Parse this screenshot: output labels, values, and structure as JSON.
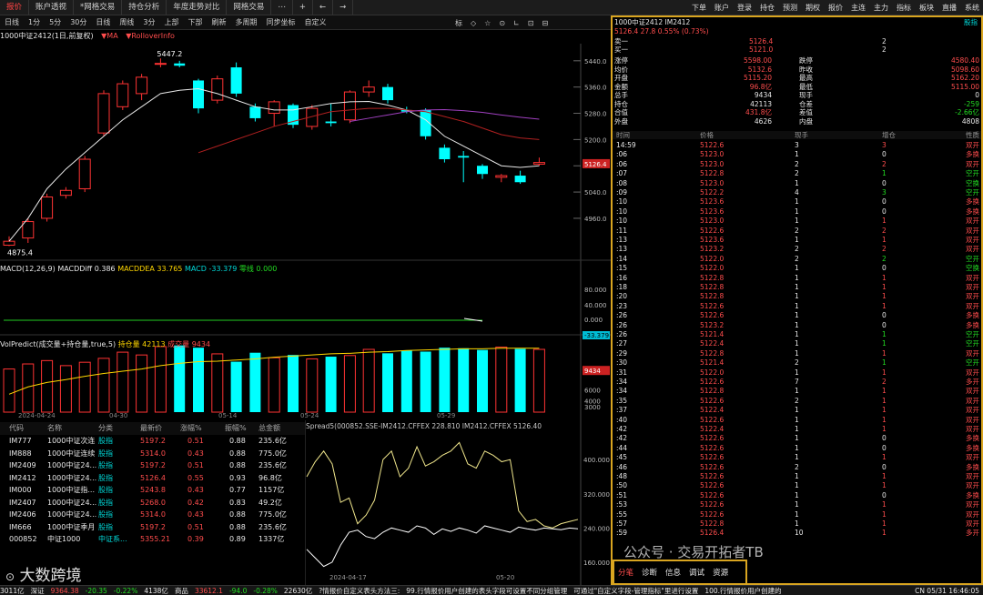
{
  "tabs": [
    {
      "label": "报价",
      "active": true
    },
    {
      "label": "账户透视"
    },
    {
      "label": "*网格交易"
    },
    {
      "label": "持仓分析"
    },
    {
      "label": "年度走势对比"
    },
    {
      "label": "网格交易"
    }
  ],
  "toolbar": {
    "close": "×",
    "add": "+",
    "prev": "←",
    "next": "→",
    "items": [
      "下单",
      "账户",
      "登录",
      "持仓",
      "预测",
      "期权",
      "报价",
      "主连",
      "主力",
      "指标",
      "板块",
      "直播",
      "系统"
    ]
  },
  "periods": [
    "日线",
    "1分",
    "5分",
    "30分",
    "日线",
    "周线",
    "3分",
    "上部",
    "下部",
    "刷新",
    "多周期",
    "同步坐标",
    "自定义"
  ],
  "period_right": [
    "标",
    "◇",
    "☆",
    "⊙",
    "∟",
    "⊡",
    "⊟"
  ],
  "chart_info": {
    "title": "1000中证2412(1日,前复权)",
    "ma": "▼MA",
    "rollover": "▼RolloverInfo"
  },
  "price_axis": [
    "5440.0",
    "5360.0",
    "5280.0",
    "5200.0",
    "5120.0",
    "5040.0",
    "4960.0"
  ],
  "current_price": "5126.4",
  "price_labels": {
    "high": "5447.2",
    "low": "4875.4"
  },
  "macd": {
    "label": "MACD(12,26,9)",
    "diff": "MACDDiff 0.386",
    "dea": "MACDDEA 33.765",
    "macd": "MACD -33.379",
    "zero": "零线 0.000",
    "axis": [
      "80.000",
      "40.000",
      "0.000"
    ],
    "value": "-33.379"
  },
  "vol": {
    "label": "VolPredict(成交量+持仓量,true,5)",
    "oi": "持仓量 42113",
    "volume": "成交量 9434",
    "axis": [
      "6000",
      "4000",
      "3000"
    ],
    "value": "9434"
  },
  "dates": [
    "2024-04-24",
    "04-30",
    "05-14",
    "05-24",
    "05-29"
  ],
  "chart_data": {
    "type": "candlestick",
    "candles": [
      {
        "o": 4878,
        "h": 4905,
        "l": 4875.4,
        "c": 4890
      },
      {
        "o": 4900,
        "h": 4960,
        "l": 4885,
        "c": 4950
      },
      {
        "o": 4960,
        "h": 5035,
        "l": 4950,
        "c": 5025
      },
      {
        "o": 5030,
        "h": 5055,
        "l": 5020,
        "c": 5045
      },
      {
        "o": 5050,
        "h": 5150,
        "l": 5040,
        "c": 5140
      },
      {
        "o": 5220,
        "h": 5350,
        "l": 5210,
        "c": 5340
      },
      {
        "o": 5300,
        "h": 5380,
        "l": 5290,
        "c": 5370
      },
      {
        "o": 5340,
        "h": 5400,
        "l": 5320,
        "c": 5390
      },
      {
        "o": 5430,
        "h": 5447.2,
        "l": 5420,
        "c": 5432
      },
      {
        "o": 5432,
        "h": 5440,
        "l": 5420,
        "c": 5425
      },
      {
        "o": 5380,
        "h": 5385,
        "l": 5280,
        "c": 5295
      },
      {
        "o": 5320,
        "h": 5395,
        "l": 5310,
        "c": 5385
      },
      {
        "o": 5420,
        "h": 5435,
        "l": 5330,
        "c": 5340
      },
      {
        "o": 5300,
        "h": 5310,
        "l": 5255,
        "c": 5265
      },
      {
        "o": 5280,
        "h": 5320,
        "l": 5240,
        "c": 5315
      },
      {
        "o": 5305,
        "h": 5310,
        "l": 5235,
        "c": 5245
      },
      {
        "o": 5240,
        "h": 5305,
        "l": 5230,
        "c": 5295
      },
      {
        "o": 5255,
        "h": 5310,
        "l": 5240,
        "c": 5250
      },
      {
        "o": 5260,
        "h": 5350,
        "l": 5250,
        "c": 5345
      },
      {
        "o": 5345,
        "h": 5380,
        "l": 5330,
        "c": 5360
      },
      {
        "o": 5360,
        "h": 5370,
        "l": 5310,
        "c": 5320
      },
      {
        "o": 5290,
        "h": 5300,
        "l": 5280,
        "c": 5285
      },
      {
        "o": 5290,
        "h": 5295,
        "l": 5200,
        "c": 5210
      },
      {
        "o": 5175,
        "h": 5185,
        "l": 5130,
        "c": 5140
      },
      {
        "o": 5150,
        "h": 5165,
        "l": 5070,
        "c": 5145
      },
      {
        "o": 5120,
        "h": 5125,
        "l": 5080,
        "c": 5095
      },
      {
        "o": 5085,
        "h": 5095,
        "l": 5070,
        "c": 5090
      },
      {
        "o": 5090,
        "h": 5105,
        "l": 5065,
        "c": 5070
      },
      {
        "o": 5125,
        "h": 5145,
        "l": 5120,
        "c": 5130
      }
    ],
    "ma_white": [
      4890,
      4960,
      5050,
      5110,
      5160,
      5210,
      5260,
      5300,
      5340,
      5350,
      5355,
      5340,
      5320,
      5300,
      5290,
      5290,
      5300,
      5310,
      5315,
      5316,
      5305,
      5290,
      5260,
      5210,
      5180,
      5150,
      5120,
      5115,
      5120
    ],
    "ma_red": [
      null,
      null,
      null,
      null,
      null,
      null,
      null,
      null,
      null,
      null,
      5160,
      5180,
      5200,
      5220,
      5240,
      5255,
      5270,
      5285,
      5290,
      5295,
      5295,
      5290,
      5285,
      5270,
      5255,
      5235,
      5215,
      5205,
      5200
    ],
    "ma_purple": [
      null,
      null,
      null,
      null,
      null,
      null,
      null,
      null,
      null,
      null,
      null,
      null,
      null,
      null,
      null,
      null,
      null,
      null,
      5255,
      5265,
      5275,
      5285,
      5290,
      5291,
      5288,
      5283,
      5275,
      5268,
      5262
    ],
    "volume": [
      9700,
      10600,
      11200,
      10300,
      10900,
      11600,
      12700,
      12200,
      13700,
      13900,
      13500,
      12400,
      11000,
      12600,
      11700,
      12200,
      11500,
      11900,
      12100,
      13200,
      12500,
      13000,
      12800,
      13500,
      13400,
      13100,
      13600,
      13300,
      13200
    ],
    "oi_line": [
      5200,
      6500,
      7300,
      7800,
      8400,
      8900,
      9300,
      9700,
      10300,
      10700,
      11000,
      11100,
      11300,
      11500,
      11800,
      12000,
      12200,
      12400,
      12500,
      12700,
      12800,
      13000,
      13100,
      13200,
      13300,
      13300,
      13400,
      13400,
      13400
    ],
    "spread_yellow": [
      360,
      395,
      420,
      390,
      300,
      310,
      250,
      270,
      305,
      400,
      420,
      360,
      380,
      430,
      385,
      395,
      410,
      420,
      440,
      390,
      380,
      420,
      410,
      395,
      400,
      280,
      255,
      260,
      245,
      240,
      250,
      255,
      260
    ],
    "spread_white": [
      190,
      170,
      150,
      160,
      200,
      230,
      235,
      220,
      215,
      230,
      240,
      235,
      230,
      245,
      240,
      225,
      238,
      232,
      240,
      235,
      228,
      245,
      240,
      235,
      230,
      242,
      238,
      235,
      240,
      238,
      236,
      240,
      238
    ]
  },
  "spread": {
    "label": "Spread5(000852.SSE-IM2412.CFFEX 228.810 IM2412.CFFEX 5126.40",
    "axis": [
      "400.000",
      "320.000",
      "240.000",
      "160.000"
    ],
    "dates": [
      "2024-04-17",
      "05-20"
    ]
  },
  "watchlist": {
    "headers": [
      "代码",
      "名称",
      "分类",
      "最新价",
      "涨幅%",
      "振幅%",
      "总金额"
    ],
    "rows": [
      [
        "IM777",
        "1000中证次连",
        "股指",
        "5197.2",
        "0.51",
        "0.88",
        "235.6亿"
      ],
      [
        "IM888",
        "1000中证连续",
        "股指",
        "5314.0",
        "0.43",
        "0.88",
        "775.0亿"
      ],
      [
        "IM2409",
        "1000中证24...",
        "股指",
        "5197.2",
        "0.51",
        "0.88",
        "235.6亿"
      ],
      [
        "IM2412",
        "1000中证24...",
        "股指",
        "5126.4",
        "0.55",
        "0.93",
        "96.8亿"
      ],
      [
        "IM000",
        "1000中证指...",
        "股指",
        "5243.8",
        "0.43",
        "0.77",
        "1157亿"
      ],
      [
        "IM2407",
        "1000中证24...",
        "股指",
        "5268.0",
        "0.42",
        "0.83",
        "49.2亿"
      ],
      [
        "IM2406",
        "1000中证24...",
        "股指",
        "5314.0",
        "0.43",
        "0.88",
        "775.0亿"
      ],
      [
        "IM666",
        "1000中证季月",
        "股指",
        "5197.2",
        "0.51",
        "0.88",
        "235.6亿"
      ],
      [
        "000852",
        "中证1000",
        "中证系...",
        "5355.21",
        "0.39",
        "0.89",
        "1337亿"
      ]
    ]
  },
  "quote": {
    "title": "1000中证2412 IM2412",
    "price_line": "5126.4  27.8  0.55%  (0.73%)",
    "button": "股指",
    "bid_ask": [
      [
        "卖一",
        "5126.4",
        "2"
      ],
      [
        "买一",
        "5121.0",
        "2"
      ]
    ],
    "stats": [
      [
        "涨停",
        "5598.00",
        "跌停",
        "4580.40"
      ],
      [
        "均价",
        "5132.6",
        "昨收",
        "5098.60"
      ],
      [
        "开盘",
        "5115.20",
        "最高",
        "5162.20"
      ],
      [
        "金额",
        "96.8亿",
        "最低",
        "5115.00"
      ],
      [
        "总手",
        "9434",
        "现手",
        "0"
      ],
      [
        "持仓",
        "42113",
        "仓差",
        "-259"
      ],
      [
        "合值",
        "431.8亿",
        "差值",
        "-2.66亿"
      ],
      [
        "外盘",
        "4626",
        "内盘",
        "4808"
      ]
    ]
  },
  "tick_headers": [
    "时间",
    "价格",
    "现手",
    "增仓",
    "性质"
  ],
  "ticks": [
    [
      "14:59",
      "5122.6",
      "3",
      "3",
      "双开",
      "red"
    ],
    [
      ":06",
      "5123.0",
      "1",
      "0",
      "多换",
      "red"
    ],
    [
      ":06",
      "5123.0",
      "2",
      "2",
      "双开",
      "red"
    ],
    [
      ":07",
      "5122.8",
      "2",
      "1",
      "空开",
      "green"
    ],
    [
      ":08",
      "5123.0",
      "1",
      "0",
      "空换",
      "green"
    ],
    [
      ":09",
      "5122.2",
      "4",
      "3",
      "空开",
      "green"
    ],
    [
      ":10",
      "5123.6",
      "1",
      "0",
      "多换",
      "red"
    ],
    [
      ":10",
      "5123.6",
      "1",
      "0",
      "多换",
      "red"
    ],
    [
      ":10",
      "5123.0",
      "1",
      "1",
      "双开",
      "red"
    ],
    [
      ":11",
      "5122.6",
      "2",
      "2",
      "双开",
      "red"
    ],
    [
      ":13",
      "5123.6",
      "1",
      "1",
      "双开",
      "red"
    ],
    [
      ":13",
      "5123.2",
      "2",
      "2",
      "双开",
      "red"
    ],
    [
      ":14",
      "5122.0",
      "2",
      "2",
      "空开",
      "green"
    ],
    [
      ":15",
      "5122.0",
      "1",
      "0",
      "空换",
      "green"
    ],
    [
      ":16",
      "5122.8",
      "1",
      "1",
      "双开",
      "red"
    ],
    [
      ":18",
      "5122.8",
      "1",
      "1",
      "双开",
      "red"
    ],
    [
      ":20",
      "5122.8",
      "1",
      "1",
      "双开",
      "red"
    ],
    [
      ":23",
      "5122.6",
      "1",
      "1",
      "双开",
      "red"
    ],
    [
      ":26",
      "5122.6",
      "1",
      "0",
      "多换",
      "red"
    ],
    [
      ":26",
      "5123.2",
      "1",
      "0",
      "多换",
      "red"
    ],
    [
      ":26",
      "5121.4",
      "1",
      "1",
      "空开",
      "green"
    ],
    [
      ":27",
      "5122.4",
      "1",
      "1",
      "空开",
      "green"
    ],
    [
      ":29",
      "5122.8",
      "1",
      "1",
      "双开",
      "red"
    ],
    [
      ":30",
      "5121.4",
      "2",
      "1",
      "空开",
      "green"
    ],
    [
      ":31",
      "5122.0",
      "1",
      "1",
      "双开",
      "red"
    ],
    [
      ":34",
      "5122.6",
      "7",
      "2",
      "多开",
      "red"
    ],
    [
      ":34",
      "5122.8",
      "1",
      "1",
      "双开",
      "red"
    ],
    [
      ":35",
      "5122.6",
      "2",
      "1",
      "双开",
      "red"
    ],
    [
      ":37",
      "5122.4",
      "1",
      "1",
      "双开",
      "red"
    ],
    [
      ":40",
      "5122.6",
      "1",
      "1",
      "双开",
      "red"
    ],
    [
      ":42",
      "5122.4",
      "1",
      "1",
      "双开",
      "red"
    ],
    [
      ":42",
      "5122.6",
      "1",
      "0",
      "多换",
      "red"
    ],
    [
      ":44",
      "5122.6",
      "1",
      "0",
      "多换",
      "red"
    ],
    [
      ":45",
      "5122.6",
      "1",
      "1",
      "双开",
      "red"
    ],
    [
      ":46",
      "5122.6",
      "2",
      "0",
      "多换",
      "red"
    ],
    [
      ":48",
      "5122.6",
      "1",
      "1",
      "双开",
      "red"
    ],
    [
      ":50",
      "5122.6",
      "1",
      "1",
      "双开",
      "red"
    ],
    [
      ":51",
      "5122.6",
      "1",
      "0",
      "多换",
      "red"
    ],
    [
      ":53",
      "5122.6",
      "1",
      "1",
      "双开",
      "red"
    ],
    [
      ":55",
      "5122.6",
      "1",
      "1",
      "双开",
      "red"
    ],
    [
      ":57",
      "5122.8",
      "1",
      "1",
      "双开",
      "red"
    ],
    [
      ":59",
      "5126.4",
      "10",
      "1",
      "多开",
      "red"
    ]
  ],
  "bottom_tabs": [
    "分笔",
    "诊断",
    "信息",
    "调试",
    "资源"
  ],
  "watermark": "公众号 · 交易开拓者TB",
  "logo_text": "大数跨境",
  "status": {
    "items": [
      {
        "t": "3011亿",
        "c": "white"
      },
      {
        "t": "深证",
        "c": "white"
      },
      {
        "t": "9364.38",
        "c": "red"
      },
      {
        "t": "-20.35",
        "c": "green"
      },
      {
        "t": "-0.22%",
        "c": "green"
      },
      {
        "t": "4138亿",
        "c": "white"
      },
      {
        "t": "商品",
        "c": "white"
      },
      {
        "t": "33612.1",
        "c": "red"
      },
      {
        "t": "-94.0",
        "c": "green"
      },
      {
        "t": "-0.28%",
        "c": "green"
      },
      {
        "t": "22630亿",
        "c": "white"
      },
      {
        "t": "?情报价自定义表头方法三:",
        "c": "white"
      },
      {
        "t": "99.行情报价用户创建的表头字段可设置不同分组管理",
        "c": "white"
      },
      {
        "t": "可通过\"自定义字段-管理指标\"里进行设置",
        "c": "white"
      },
      {
        "t": "100.行情报价用户创建的",
        "c": "white"
      }
    ],
    "right": "CN 05/31 16:46:05"
  }
}
